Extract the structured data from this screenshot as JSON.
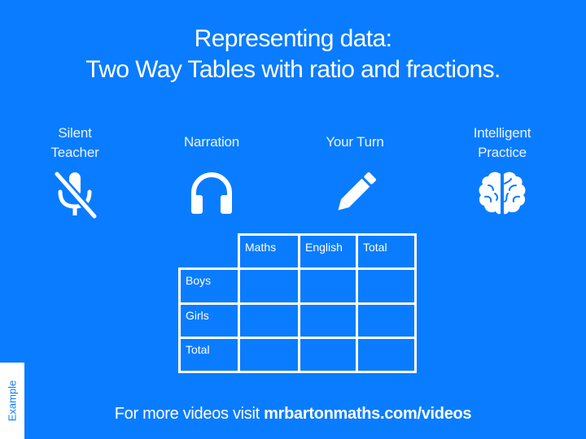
{
  "slide": {
    "background_color": "#0a7cff",
    "title_line1": "Representing data:",
    "title_line2": "Two Way Tables with ratio and fractions."
  },
  "features": [
    {
      "label_line1": "Silent",
      "label_line2": "Teacher",
      "icon": "microphone-muted-icon"
    },
    {
      "label_line1": "Narration",
      "label_line2": "",
      "icon": "headphones-icon"
    },
    {
      "label_line1": "Your Turn",
      "label_line2": "",
      "icon": "pencil-icon"
    },
    {
      "label_line1": "Intelligent",
      "label_line2": "Practice",
      "icon": "brain-icon"
    }
  ],
  "table": {
    "columns": [
      "",
      "Maths",
      "English",
      "Total"
    ],
    "rows": [
      {
        "label": "Boys",
        "cells": [
          "",
          "",
          ""
        ]
      },
      {
        "label": "Girls",
        "cells": [
          "",
          "",
          ""
        ]
      },
      {
        "label": "Total",
        "cells": [
          "",
          "",
          ""
        ]
      }
    ]
  },
  "side_tab": {
    "label": "Example"
  },
  "footer": {
    "prefix": "For more videos visit ",
    "link": "mrbartonmaths.com/videos"
  }
}
